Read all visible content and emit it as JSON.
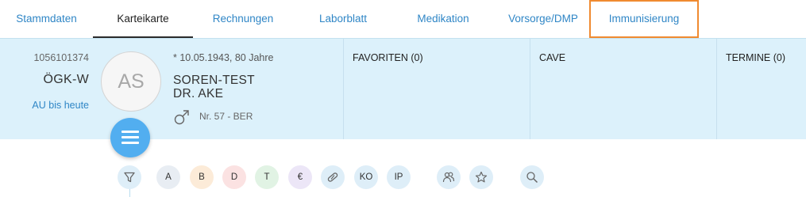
{
  "tabs": [
    {
      "label": "Stammdaten"
    },
    {
      "label": "Karteikarte"
    },
    {
      "label": "Rechnungen"
    },
    {
      "label": "Laborblatt"
    },
    {
      "label": "Medikation"
    },
    {
      "label": "Vorsorge/DMP"
    },
    {
      "label": "Immunisierung"
    }
  ],
  "active_tab": "Karteikarte",
  "highlighted_tab": "Immunisierung",
  "patient": {
    "id": "1056101374",
    "insurance": "ÖGK-W",
    "au_link": "AU bis heute",
    "initials": "AS",
    "birth": "* 10.05.1943, 80 Jahre",
    "last_name": "SOREN-TEST",
    "first_name": "DR. AKE",
    "gender_icon": "male-icon",
    "room": "Nr. 57 - BER"
  },
  "sections": {
    "favoriten": "FAVORITEN (0)",
    "cave": "CAVE",
    "termine": "TERMINE (0)"
  },
  "filters": [
    {
      "label": "A",
      "color": "#e8edf3"
    },
    {
      "label": "B",
      "color": "#fcebd8"
    },
    {
      "label": "D",
      "color": "#fbe2e2"
    },
    {
      "label": "T",
      "color": "#e1f3e4"
    },
    {
      "label": "€",
      "color": "#ece6f7"
    },
    {
      "label": "KO",
      "color": "#deeef8"
    },
    {
      "label": "IP",
      "color": "#deeef8"
    }
  ],
  "icons": {
    "filter": "filter-icon",
    "pill": "pill-icon",
    "persons": "persons-icon",
    "star": "star-icon",
    "search": "search-icon",
    "menu": "menu-icon"
  },
  "colors": {
    "accent": "#2f86c6",
    "band_background": "#dcf1fb",
    "menu_button": "#52aef0",
    "highlight_border": "#f08a30"
  }
}
